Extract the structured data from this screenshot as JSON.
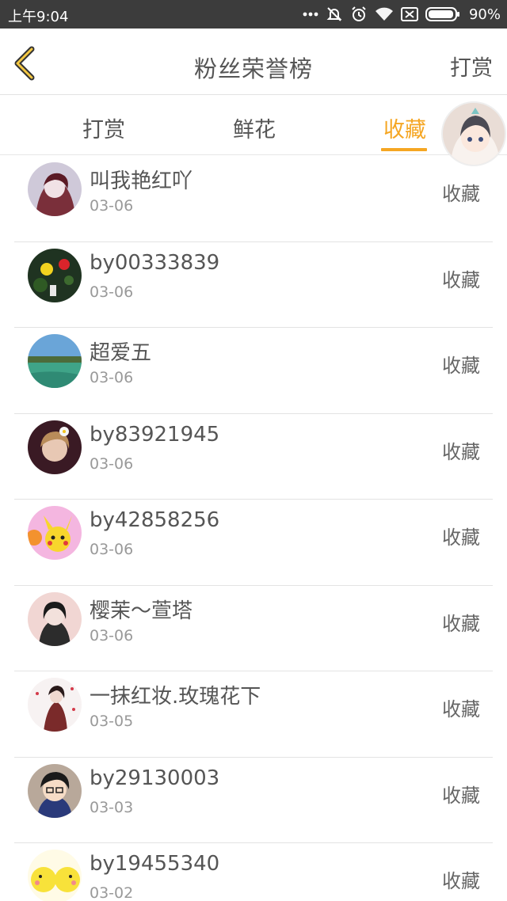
{
  "status_bar": {
    "time": "上午9:04",
    "battery": "90%",
    "icons": [
      "more-dots-icon",
      "mute-bell-icon",
      "alarm-icon",
      "wifi-icon",
      "sim-icon",
      "battery-icon"
    ]
  },
  "header": {
    "title": "粉丝荣誉榜",
    "right_action": "打赏",
    "back_icon": "chevron-left-icon",
    "accent_color": "#f5a623"
  },
  "tabs": [
    {
      "label": "打赏",
      "active": false
    },
    {
      "label": "鲜花",
      "active": false
    },
    {
      "label": "收藏",
      "active": true
    }
  ],
  "list": [
    {
      "name": "叫我艳红吖",
      "date": "03-06",
      "action": "收藏"
    },
    {
      "name": "by00333839",
      "date": "03-06",
      "action": "收藏"
    },
    {
      "name": "超爱五",
      "date": "03-06",
      "action": "收藏"
    },
    {
      "name": "by83921945",
      "date": "03-06",
      "action": "收藏"
    },
    {
      "name": "by42858256",
      "date": "03-06",
      "action": "收藏"
    },
    {
      "name": "樱茉～萱塔",
      "date": "03-06",
      "action": "收藏"
    },
    {
      "name": "一抹红妆.玫瑰花下",
      "date": "03-05",
      "action": "收藏"
    },
    {
      "name": "by29130003",
      "date": "03-03",
      "action": "收藏"
    },
    {
      "name": "by19455340",
      "date": "03-02",
      "action": "收藏"
    }
  ]
}
